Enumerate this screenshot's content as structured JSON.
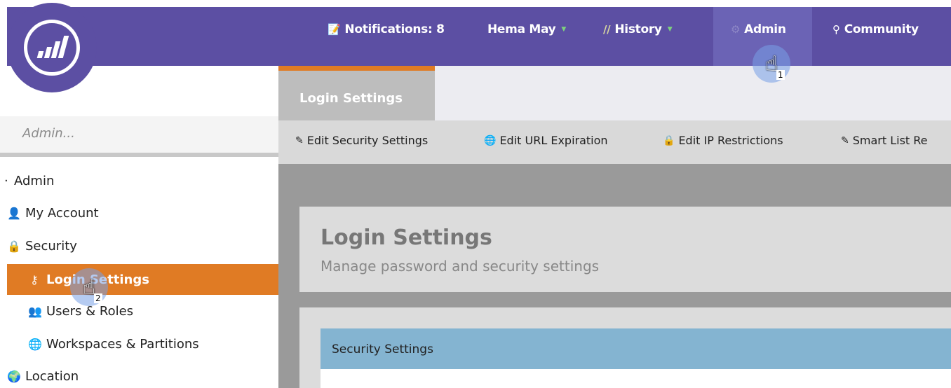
{
  "topnav": {
    "notifications": "Notifications: 8",
    "user": "Hema May",
    "history": "History",
    "admin": "Admin",
    "community": "Community"
  },
  "sidebar": {
    "search_placeholder": "Admin...",
    "items": [
      {
        "label": "Admin",
        "icon": "bullet-icon"
      },
      {
        "label": "My Account",
        "icon": "person-icon"
      },
      {
        "label": "Security",
        "icon": "lock-icon"
      },
      {
        "label": "Login Settings",
        "icon": "key-icon",
        "active": true
      },
      {
        "label": "Users & Roles",
        "icon": "users-icon"
      },
      {
        "label": "Workspaces & Partitions",
        "icon": "globe-icon"
      },
      {
        "label": "Location",
        "icon": "location-globe-icon"
      }
    ]
  },
  "main": {
    "tab": "Login Settings",
    "toolbar": [
      "Edit Security Settings",
      "Edit URL Expiration",
      "Edit IP Restrictions",
      "Smart List Re"
    ],
    "title": "Login Settings",
    "subtitle": "Manage password and security settings",
    "section": "Security Settings"
  },
  "cursors": [
    "1",
    "2"
  ],
  "colors": {
    "topbar": "#5c4fa3",
    "active": "#e07b24",
    "section": "#84b4d1"
  }
}
